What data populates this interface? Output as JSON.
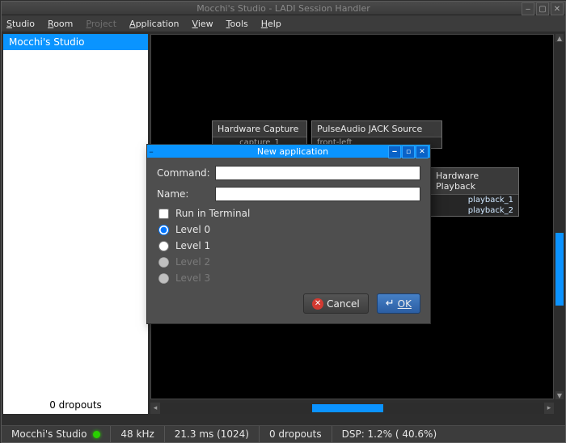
{
  "window": {
    "title": "Mocchi's Studio - LADI Session Handler"
  },
  "menu": {
    "studio": "Studio",
    "room": "Room",
    "project": "Project",
    "application": "Application",
    "view": "View",
    "tools": "Tools",
    "help": "Help"
  },
  "sidebar": {
    "header": "Mocchi's Studio",
    "footer": "0 dropouts"
  },
  "nodes": {
    "hwcap": {
      "title": "Hardware Capture",
      "port1": "capture_1"
    },
    "pasrc": {
      "title": "PulseAudio JACK Source",
      "port1": "front-left"
    },
    "hwplay": {
      "title": "Hardware Playback",
      "port1": "playback_1",
      "port2": "playback_2"
    }
  },
  "dialog": {
    "title": "New application",
    "command_label": "Command:",
    "name_label": "Name:",
    "command_value": "",
    "name_value": "",
    "run_terminal": "Run in Terminal",
    "level0": "Level 0",
    "level1": "Level 1",
    "level2": "Level 2",
    "level3": "Level 3",
    "selected_level": "level0",
    "cancel": "Cancel",
    "ok": "OK"
  },
  "status": {
    "studio": "Mocchi's Studio",
    "rate": "48 kHz",
    "latency": "21.3 ms (1024)",
    "dropouts": "0 dropouts",
    "dsp": "DSP:    1.2% ( 40.6%)"
  }
}
